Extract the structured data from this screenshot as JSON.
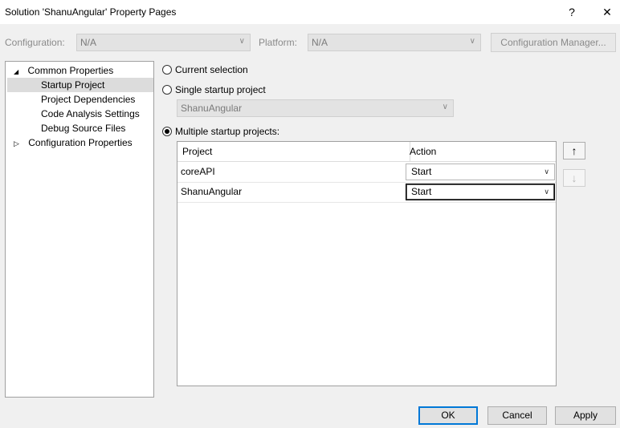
{
  "window": {
    "title": "Solution 'ShanuAngular' Property Pages",
    "help": "?",
    "close": "✕"
  },
  "toolbar": {
    "configuration_label": "Configuration:",
    "configuration_value": "N/A",
    "platform_label": "Platform:",
    "platform_value": "N/A",
    "config_manager_label": "Configuration Manager..."
  },
  "tree": {
    "items": [
      {
        "label": "Common Properties",
        "expander": "◢"
      },
      {
        "label": "Startup Project"
      },
      {
        "label": "Project Dependencies"
      },
      {
        "label": "Code Analysis Settings"
      },
      {
        "label": "Debug Source Files"
      },
      {
        "label": "Configuration Properties",
        "expander": "▷"
      }
    ]
  },
  "startup": {
    "current_selection": "Current selection",
    "single_label": "Single startup project",
    "single_value": "ShanuAngular",
    "multiple_label": "Multiple startup projects:"
  },
  "grid": {
    "headers": {
      "project": "Project",
      "action": "Action"
    },
    "rows": [
      {
        "project": "coreAPI",
        "action": "Start"
      },
      {
        "project": "ShanuAngular",
        "action": "Start"
      }
    ]
  },
  "icons": {
    "up": "arrow-up-icon",
    "down": "arrow-down-icon"
  },
  "buttons": {
    "ok": "OK",
    "cancel": "Cancel",
    "apply": "Apply"
  }
}
